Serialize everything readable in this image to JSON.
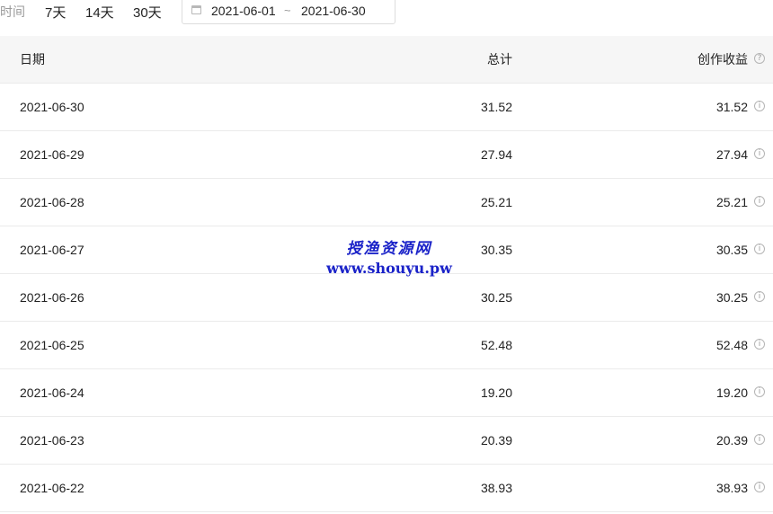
{
  "toolbar": {
    "time_label": "时间",
    "ranges": [
      "7天",
      "14天",
      "30天"
    ],
    "date_start": "2021-06-01",
    "date_separator": "~",
    "date_end": "2021-06-30"
  },
  "table": {
    "headers": {
      "date": "日期",
      "total": "总计",
      "income": "创作收益"
    },
    "rows": [
      {
        "date": "2021-06-30",
        "total": "31.52",
        "income": "31.52"
      },
      {
        "date": "2021-06-29",
        "total": "27.94",
        "income": "27.94"
      },
      {
        "date": "2021-06-28",
        "total": "25.21",
        "income": "25.21"
      },
      {
        "date": "2021-06-27",
        "total": "30.35",
        "income": "30.35"
      },
      {
        "date": "2021-06-26",
        "total": "30.25",
        "income": "30.25"
      },
      {
        "date": "2021-06-25",
        "total": "52.48",
        "income": "52.48"
      },
      {
        "date": "2021-06-24",
        "total": "19.20",
        "income": "19.20"
      },
      {
        "date": "2021-06-23",
        "total": "20.39",
        "income": "20.39"
      },
      {
        "date": "2021-06-22",
        "total": "38.93",
        "income": "38.93"
      }
    ]
  },
  "icons": {
    "header_help": "question-circle-icon",
    "row_info": "info-circle-icon",
    "calendar": "calendar-icon"
  },
  "watermark": {
    "title": "授渔资源网",
    "url": "www.shouyu.pw"
  },
  "colors": {
    "header_bg": "#f6f6f6",
    "row_border": "#ebebeb",
    "watermark": "#1a22c8"
  }
}
